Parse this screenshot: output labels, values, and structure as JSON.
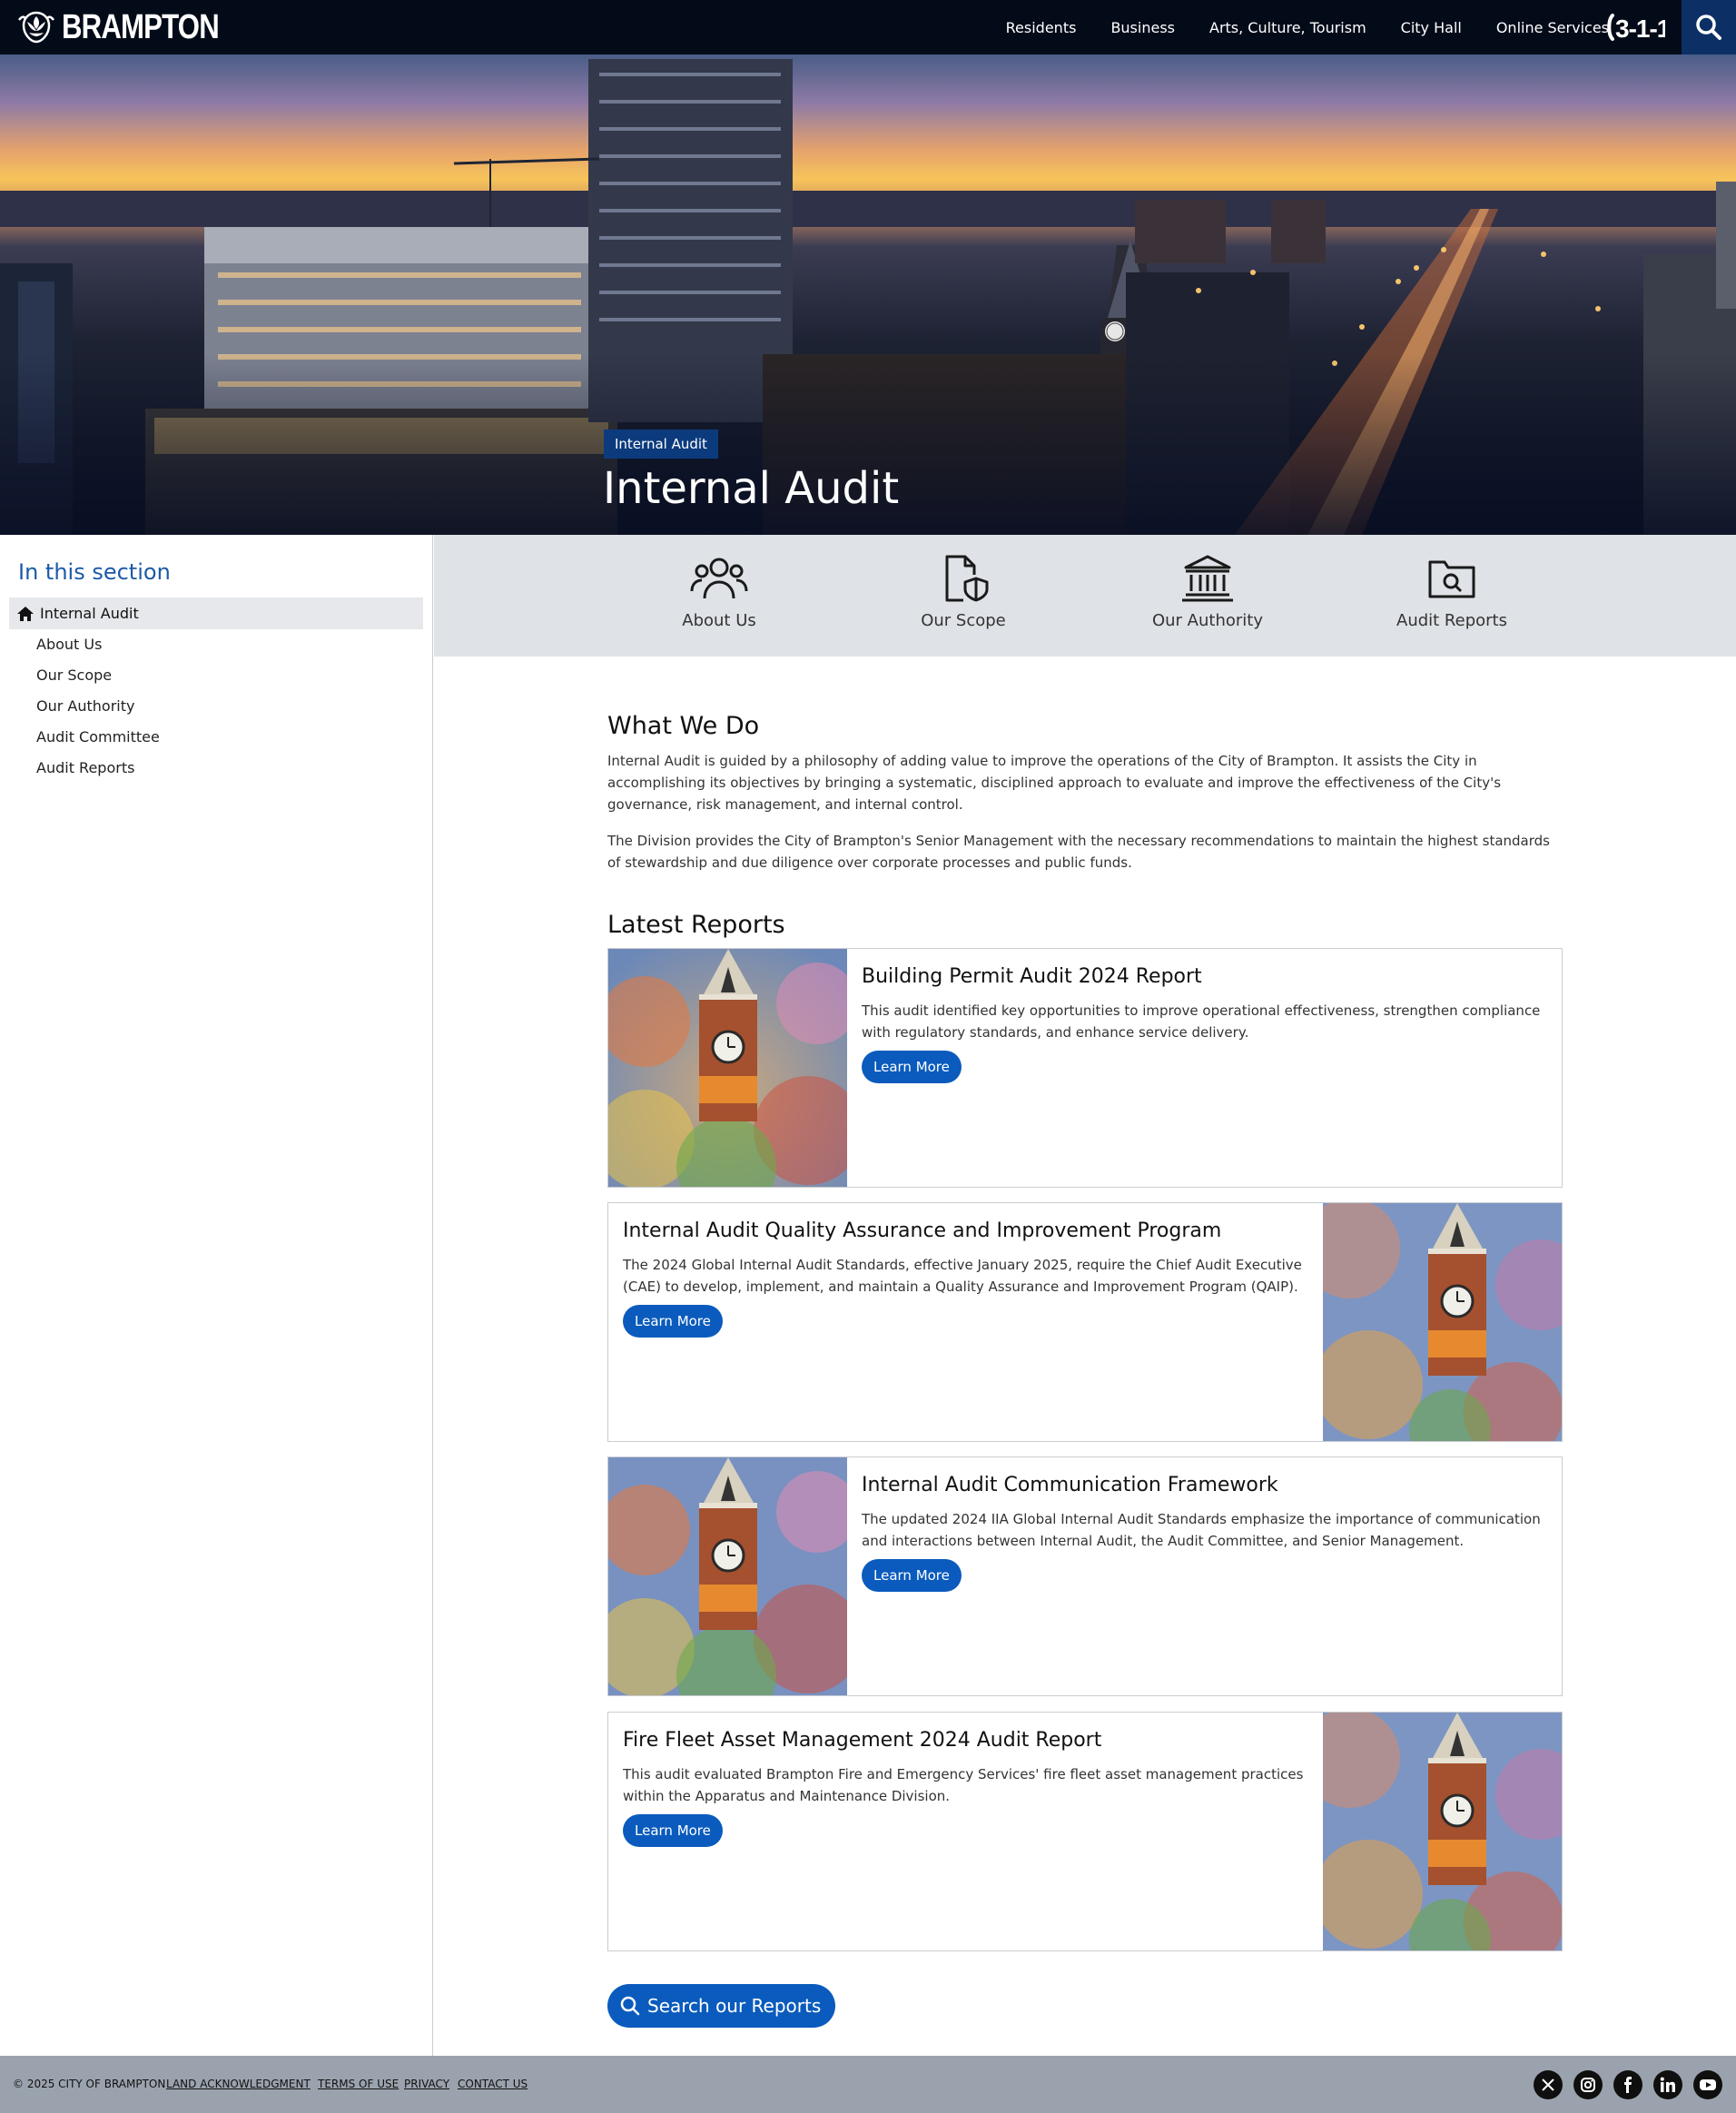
{
  "nav": {
    "logo_text": "BRAMPTON",
    "links": [
      "Residents",
      "Business",
      "Arts, Culture, Tourism",
      "City Hall",
      "Online Services"
    ],
    "phone_label": "3-1-1"
  },
  "hero": {
    "badge": "Internal Audit",
    "title": "Internal Audit"
  },
  "sidebar": {
    "title": "In this section",
    "active": "Internal Audit",
    "items": [
      "About Us",
      "Our Scope",
      "Our Authority",
      "Audit Committee",
      "Audit Reports"
    ]
  },
  "iconband": {
    "items": [
      {
        "label": "About Us",
        "icon": "people-icon"
      },
      {
        "label": "Our Scope",
        "icon": "document-shield-icon"
      },
      {
        "label": "Our Authority",
        "icon": "government-building-icon"
      },
      {
        "label": "Audit Reports",
        "icon": "folder-search-icon"
      }
    ]
  },
  "what_we_do": {
    "heading": "What We Do",
    "p1": "Internal Audit is guided by a philosophy of adding value to improve the operations of the City of Brampton. It assists the City in accomplishing its objectives by bringing a systematic, disciplined approach to evaluate and improve the effectiveness of the City's governance, risk management, and internal control.",
    "p2": "The Division provides the City of Brampton's Senior Management with the necessary recommendations to maintain the highest standards of stewardship and due diligence over corporate processes and public funds."
  },
  "latest_reports": {
    "heading": "Latest Reports",
    "cards": [
      {
        "title": "Building Permit Audit 2024 Report",
        "desc": "This audit identified key opportunities to improve operational effectiveness, strengthen compliance with regulatory standards, and enhance service delivery.",
        "button": "Learn More"
      },
      {
        "title": "Internal Audit Quality Assurance and Improvement Program",
        "desc": "The 2024 Global Internal Audit Standards, effective January 2025, require the Chief Audit Executive (CAE) to develop, implement, and maintain a Quality Assurance and Improvement Program (QAIP).",
        "button": "Learn More"
      },
      {
        "title": "Internal Audit Communication Framework",
        "desc": "The updated 2024 IIA Global Internal Audit Standards emphasize the importance of communication and interactions between Internal Audit, the Audit Committee, and Senior Management.",
        "button": "Learn More"
      },
      {
        "title": "Fire Fleet Asset Management 2024 Audit Report",
        "desc": "This audit evaluated Brampton Fire and Emergency Services' fire fleet asset management practices within the Apparatus and Maintenance Division.",
        "button": "Learn More"
      }
    ],
    "search_button": "Search our Reports"
  },
  "footer": {
    "copyright": "© 2025 CITY OF BRAMPTON",
    "links": [
      "LAND ACKNOWLEDGMENT",
      "TERMS OF USE",
      "PRIVACY",
      "CONTACT US"
    ],
    "social": [
      "x-icon",
      "instagram-icon",
      "facebook-icon",
      "linkedin-icon",
      "youtube-icon"
    ]
  },
  "colors": {
    "nav_bg": "#040b18",
    "accent_blue": "#0a5bbd",
    "sidebar_title": "#1c5aa8",
    "band_bg": "#dfe2e6",
    "footer_bg": "#9aa3ad"
  }
}
